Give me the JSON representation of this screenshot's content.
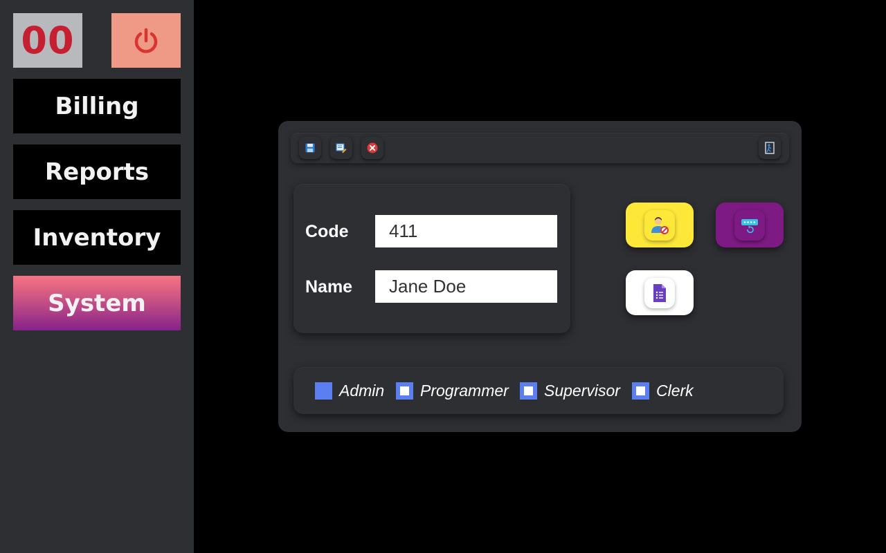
{
  "sidebar": {
    "counter": "00",
    "items": [
      {
        "label": "Billing"
      },
      {
        "label": "Reports"
      },
      {
        "label": "Inventory"
      },
      {
        "label": "System",
        "active": true
      }
    ]
  },
  "toolbar": {
    "icons": [
      "save-icon",
      "edit-icon",
      "close-icon",
      "exit-icon"
    ]
  },
  "form": {
    "code_label": "Code",
    "code_value": "411",
    "name_label": "Name",
    "name_value": "Jane Doe"
  },
  "actions": [
    {
      "icon": "block-user-icon",
      "color": "#fde83a"
    },
    {
      "icon": "reset-password-icon",
      "color": "#7e1a84"
    },
    {
      "icon": "form-document-icon",
      "color": "#ffffff"
    }
  ],
  "roles": [
    {
      "label": "Admin",
      "checked": true
    },
    {
      "label": "Programmer",
      "checked": false
    },
    {
      "label": "Supervisor",
      "checked": false
    },
    {
      "label": "Clerk",
      "checked": false
    }
  ],
  "colors": {
    "sidebar_bg": "#2e2f33",
    "counter_text": "#c42032",
    "power_bg": "#ee9a87",
    "active_gradient": [
      "#f77480",
      "#86228a"
    ],
    "checkbox": "#5b7ff1"
  }
}
